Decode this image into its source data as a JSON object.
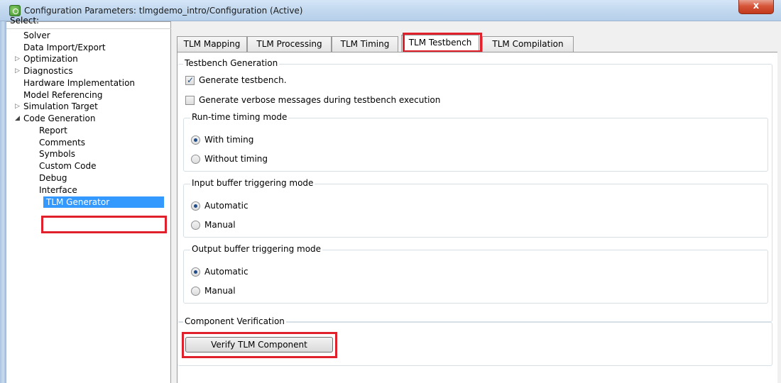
{
  "window": {
    "title": "Configuration Parameters: tlmgdemo_intro/Configuration (Active)",
    "close_glyph": "x"
  },
  "tree": {
    "header": "Select:",
    "items": [
      {
        "label": "Solver",
        "expandable": false
      },
      {
        "label": "Data Import/Export",
        "expandable": false
      },
      {
        "label": "Optimization",
        "expandable": true,
        "expanded": false
      },
      {
        "label": "Diagnostics",
        "expandable": true,
        "expanded": false
      },
      {
        "label": "Hardware Implementation",
        "expandable": false
      },
      {
        "label": "Model Referencing",
        "expandable": false
      },
      {
        "label": "Simulation Target",
        "expandable": true,
        "expanded": false
      },
      {
        "label": "Code Generation",
        "expandable": true,
        "expanded": true
      },
      {
        "label": "Report",
        "expandable": false
      },
      {
        "label": "Comments",
        "expandable": false
      },
      {
        "label": "Symbols",
        "expandable": false
      },
      {
        "label": "Custom Code",
        "expandable": false
      },
      {
        "label": "Debug",
        "expandable": false
      },
      {
        "label": "Interface",
        "expandable": false
      },
      {
        "label": "TLM Generator",
        "expandable": false,
        "selected": true
      }
    ]
  },
  "tabs": [
    {
      "label": "TLM Mapping"
    },
    {
      "label": "TLM Processing"
    },
    {
      "label": "TLM Timing"
    },
    {
      "label": "TLM Testbench",
      "active": true
    },
    {
      "label": "TLM Compilation"
    }
  ],
  "testbench": {
    "group_title": "Testbench Generation",
    "generate_testbench": {
      "label": "Generate testbench.",
      "checked": true
    },
    "verbose_messages": {
      "label": "Generate verbose messages during testbench execution",
      "checked": false
    },
    "runtime_timing": {
      "title": "Run-time timing mode",
      "options": [
        "With timing",
        "Without timing"
      ],
      "selected": "With timing"
    },
    "input_buffer": {
      "title": "Input buffer triggering mode",
      "options": [
        "Automatic",
        "Manual"
      ],
      "selected": "Automatic"
    },
    "output_buffer": {
      "title": "Output buffer triggering mode",
      "options": [
        "Automatic",
        "Manual"
      ],
      "selected": "Automatic"
    }
  },
  "verification": {
    "group_title": "Component Verification",
    "button_label": "Verify TLM Component"
  },
  "colors": {
    "highlight": "#e0202a",
    "selection": "#3399ff"
  }
}
